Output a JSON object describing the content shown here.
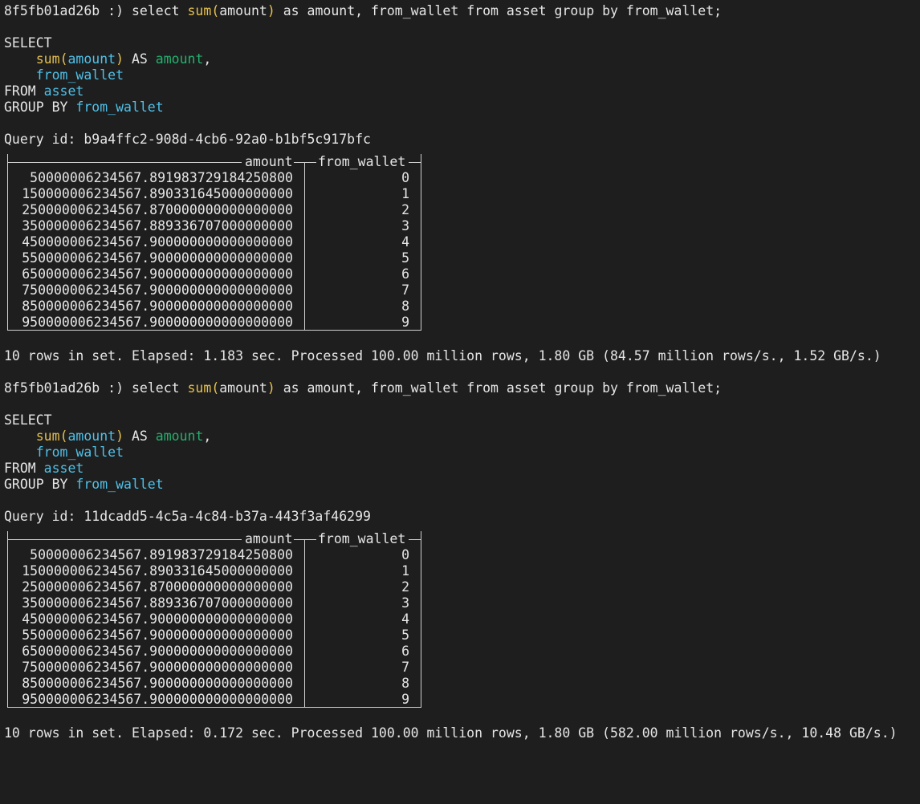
{
  "colors": {
    "background": "#1e1e1e",
    "text": "#e6e6e6",
    "function": "#e5c04f",
    "identifier": "#4fc1e9",
    "alias": "#23b26f",
    "border": "#cfcfcf"
  },
  "blocks": [
    {
      "prompt": {
        "host": "8f5fb01ad26b :) ",
        "cmd_pre": "select ",
        "fn": "sum",
        "paren_open": "(",
        "arg": "amount",
        "paren_close": ")",
        "cmd_post": " as amount, from_wallet from asset group by from_wallet;"
      },
      "formatted": {
        "select_kw": "SELECT",
        "line2_fn": "sum",
        "line2_open": "(",
        "line2_arg": "amount",
        "line2_close": ")",
        "line2_as": " AS ",
        "line2_alias": "amount",
        "line2_comma": ",",
        "line3_ident": "from_wallet",
        "from_kw": "FROM ",
        "from_table": "asset",
        "group_kw": "GROUP BY ",
        "group_col": "from_wallet"
      },
      "query_id_label": "Query id: ",
      "query_id": "b9a4ffc2-908d-4cb6-92a0-b1bf5c917bfc",
      "table": {
        "columns": [
          "amount",
          "from_wallet"
        ],
        "rows": [
          [
            "50000006234567.891983729184250800",
            "0"
          ],
          [
            "150000006234567.890331645000000000",
            "1"
          ],
          [
            "250000006234567.870000000000000000",
            "2"
          ],
          [
            "350000006234567.889336707000000000",
            "3"
          ],
          [
            "450000006234567.900000000000000000",
            "4"
          ],
          [
            "550000006234567.900000000000000000",
            "5"
          ],
          [
            "650000006234567.900000000000000000",
            "6"
          ],
          [
            "750000006234567.900000000000000000",
            "7"
          ],
          [
            "850000006234567.900000000000000000",
            "8"
          ],
          [
            "950000006234567.900000000000000000",
            "9"
          ]
        ]
      },
      "summary": "10 rows in set. Elapsed: 1.183 sec. Processed 100.00 million rows, 1.80 GB (84.57 million rows/s., 1.52 GB/s.)"
    },
    {
      "prompt": {
        "host": "8f5fb01ad26b :) ",
        "cmd_pre": "select ",
        "fn": "sum",
        "paren_open": "(",
        "arg": "amount",
        "paren_close": ")",
        "cmd_post": " as amount, from_wallet from asset group by from_wallet;"
      },
      "formatted": {
        "select_kw": "SELECT",
        "line2_fn": "sum",
        "line2_open": "(",
        "line2_arg": "amount",
        "line2_close": ")",
        "line2_as": " AS ",
        "line2_alias": "amount",
        "line2_comma": ",",
        "line3_ident": "from_wallet",
        "from_kw": "FROM ",
        "from_table": "asset",
        "group_kw": "GROUP BY ",
        "group_col": "from_wallet"
      },
      "query_id_label": "Query id: ",
      "query_id": "11dcadd5-4c5a-4c84-b37a-443f3af46299",
      "table": {
        "columns": [
          "amount",
          "from_wallet"
        ],
        "rows": [
          [
            "50000006234567.891983729184250800",
            "0"
          ],
          [
            "150000006234567.890331645000000000",
            "1"
          ],
          [
            "250000006234567.870000000000000000",
            "2"
          ],
          [
            "350000006234567.889336707000000000",
            "3"
          ],
          [
            "450000006234567.900000000000000000",
            "4"
          ],
          [
            "550000006234567.900000000000000000",
            "5"
          ],
          [
            "650000006234567.900000000000000000",
            "6"
          ],
          [
            "750000006234567.900000000000000000",
            "7"
          ],
          [
            "850000006234567.900000000000000000",
            "8"
          ],
          [
            "950000006234567.900000000000000000",
            "9"
          ]
        ]
      },
      "summary": "10 rows in set. Elapsed: 0.172 sec. Processed 100.00 million rows, 1.80 GB (582.00 million rows/s., 10.48 GB/s.)"
    }
  ]
}
